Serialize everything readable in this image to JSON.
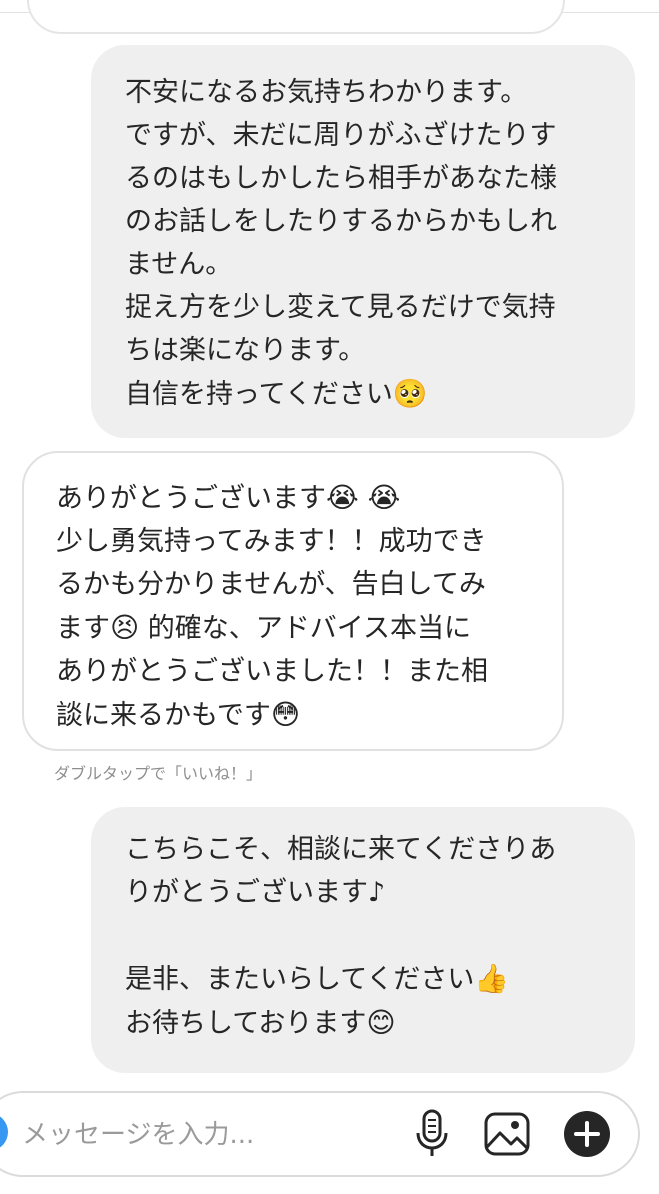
{
  "messages": [
    {
      "direction": "outgoing",
      "lines": [
        "不安になるお気持ちわかります。",
        "ですが、未だに周りがふざけたりす",
        "るのはもしかしたら相手があなた様",
        "のお話しをしたりするからかもしれ",
        "ません。",
        "捉え方を少し変えて見るだけで気持",
        "ちは楽になります。",
        "自信を持ってください"
      ],
      "trailing_emoji": "🥺"
    },
    {
      "direction": "incoming",
      "lines": [
        "ありがとうございます",
        "少し勇気持ってみます！！成功でき",
        "るかも分かりませんが、告白してみ",
        "ます",
        "ありがとうございました！！また相",
        "談に来るかもです"
      ],
      "line1_emoji": "😭 😭",
      "line4_emoji": "😣",
      "line4_suffix": " 的確な、アドバイス本当に",
      "line6_emoji": "😳"
    },
    {
      "direction": "outgoing",
      "lines": [
        "こちらこそ、相談に来てくださりあ",
        "りがとうございます♪",
        "",
        "是非、またいらしてください",
        "お待ちしております"
      ],
      "line4_emoji": "👍",
      "line5_emoji": "😊"
    }
  ],
  "like_hint": "ダブルタップで「いいね！」",
  "composer": {
    "placeholder": "メッセージを入力..."
  },
  "icons": {
    "mic": "microphone-icon",
    "gallery": "gallery-icon",
    "add": "plus-icon",
    "camera": "camera-icon"
  },
  "colors": {
    "outgoing_bubble": "#efefef",
    "incoming_border": "#e1e1e1",
    "text": "#262626",
    "hint": "#8e8e8e",
    "camera_button": "#3897f0"
  }
}
